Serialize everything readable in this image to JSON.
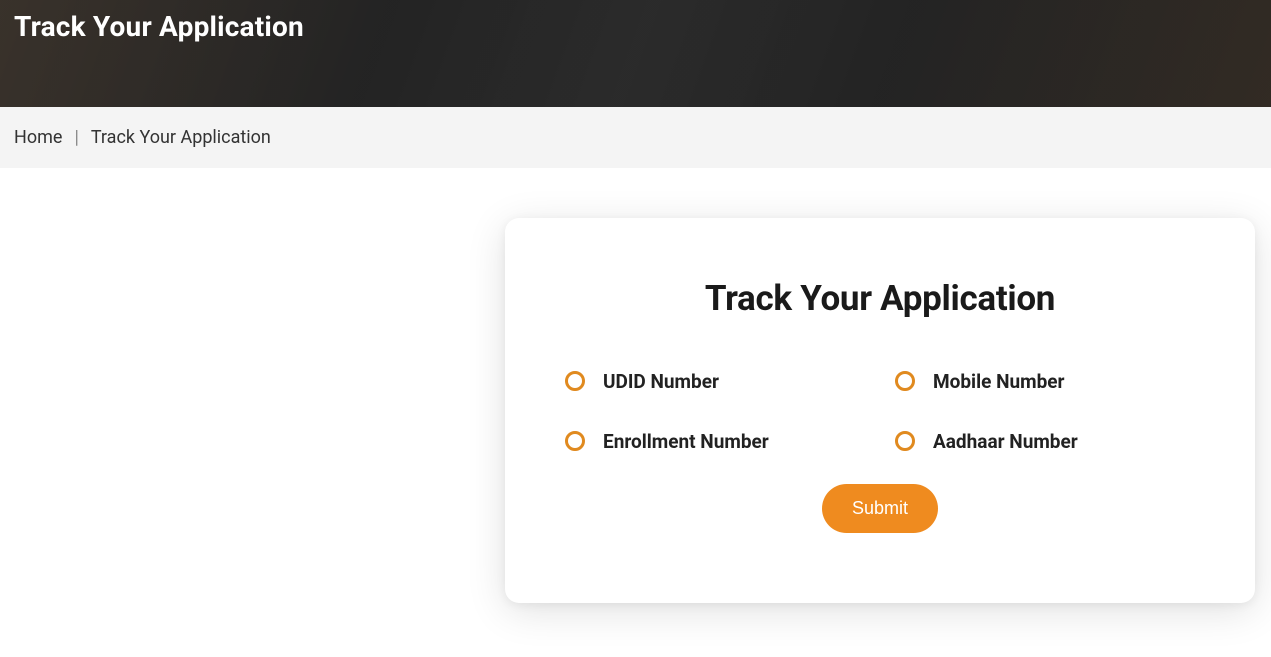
{
  "hero": {
    "title": "Track Your Application"
  },
  "breadcrumb": {
    "home": "Home",
    "separator": "|",
    "current": "Track Your Application"
  },
  "card": {
    "title": "Track Your Application",
    "options": {
      "udid": "UDID Number",
      "mobile": "Mobile Number",
      "enrollment": "Enrollment Number",
      "aadhaar": "Aadhaar Number"
    },
    "submit": "Submit"
  }
}
